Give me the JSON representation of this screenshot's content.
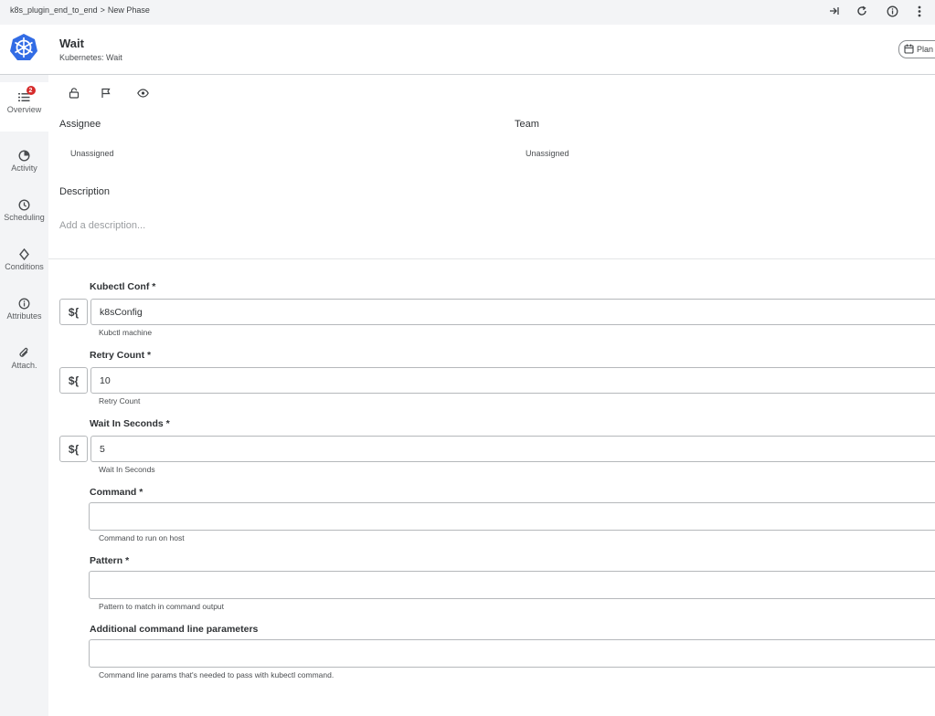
{
  "breadcrumb": {
    "parent": "k8s_plugin_end_to_end",
    "separator": ">",
    "current": "New Phase"
  },
  "top_actions": [
    {
      "name": "collapse-icon",
      "glyph": "⇥"
    },
    {
      "name": "refresh-icon",
      "glyph": "↻"
    },
    {
      "name": "info-icon",
      "glyph": "i"
    },
    {
      "name": "more-icon",
      "glyph": "⋮"
    }
  ],
  "header": {
    "title": "Wait",
    "subtitle": "Kubernetes: Wait",
    "plan_button": "Plan",
    "logo_color": "#326ce5"
  },
  "sidebar": {
    "items": [
      {
        "label": "Overview",
        "icon": "list-icon",
        "badge": "2",
        "active": true
      },
      {
        "label": "Activity",
        "icon": "pie-icon"
      },
      {
        "label": "Scheduling",
        "icon": "clock-icon"
      },
      {
        "label": "Conditions",
        "icon": "diamond-icon"
      },
      {
        "label": "Attributes",
        "icon": "info-circle-icon"
      },
      {
        "label": "Attach.",
        "icon": "paperclip-icon"
      }
    ]
  },
  "toolbar_icons": [
    "lock-icon",
    "flag-icon",
    "eye-icon"
  ],
  "assignee": {
    "label": "Assignee",
    "value": "Unassigned"
  },
  "team": {
    "label": "Team",
    "value": "Unassigned"
  },
  "description": {
    "label": "Description",
    "placeholder": "Add a description..."
  },
  "fields": {
    "var_button": "${",
    "kubectl_conf": {
      "label": "Kubectl Conf *",
      "value": "k8sConfig",
      "hint": "Kubctl machine"
    },
    "retry_count": {
      "label": "Retry Count *",
      "value": "10",
      "hint": "Retry Count"
    },
    "wait_seconds": {
      "label": "Wait In Seconds *",
      "value": "5",
      "hint": "Wait In Seconds"
    },
    "command": {
      "label": "Command *",
      "value": "",
      "hint": "Command to run on host"
    },
    "pattern": {
      "label": "Pattern *",
      "value": "",
      "hint": "Pattern to match in command output"
    },
    "additional_params": {
      "label": "Additional command line parameters",
      "value": "",
      "hint": "Command line params that's needed to pass with kubectl command."
    }
  },
  "colors": {
    "badge": "#d62b2b",
    "sidebar_bg": "#f3f4f6",
    "topbar_bg": "#f3f4f6"
  }
}
